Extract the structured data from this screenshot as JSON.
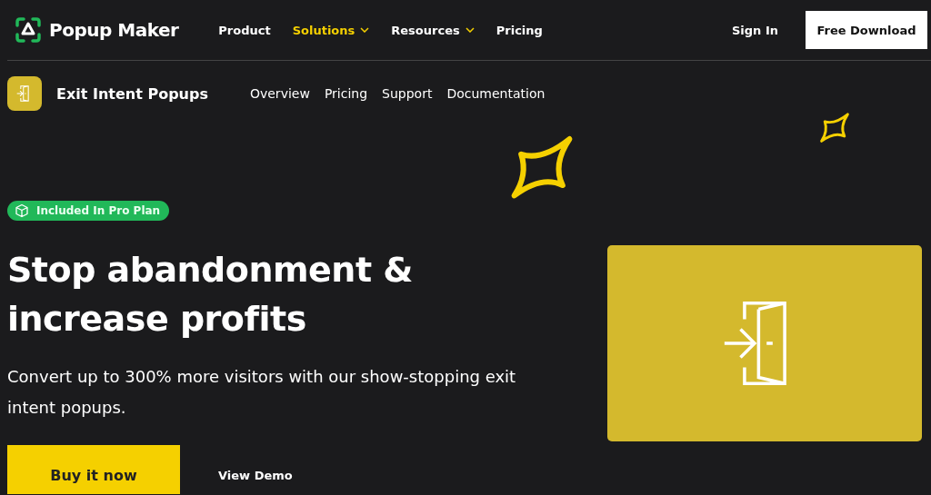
{
  "brand": {
    "name": "Popup Maker"
  },
  "nav": [
    {
      "label": "Product",
      "selected": false,
      "dropdown": false
    },
    {
      "label": "Solutions",
      "selected": true,
      "dropdown": true
    },
    {
      "label": "Resources",
      "selected": false,
      "dropdown": true
    },
    {
      "label": "Pricing",
      "selected": false,
      "dropdown": false
    }
  ],
  "sign_in": "Sign In",
  "cta": "Free Download",
  "subnav": {
    "title": "Exit Intent Popups",
    "links": [
      "Overview",
      "Pricing",
      "Support",
      "Documentation"
    ]
  },
  "hero": {
    "badge": "Included In Pro Plan",
    "heading": "Stop abandonment & increase profits",
    "text": "Convert up to 300% more visitors with our show-stopping exit intent popups.",
    "primary": "Buy it now",
    "secondary": "View Demo"
  }
}
